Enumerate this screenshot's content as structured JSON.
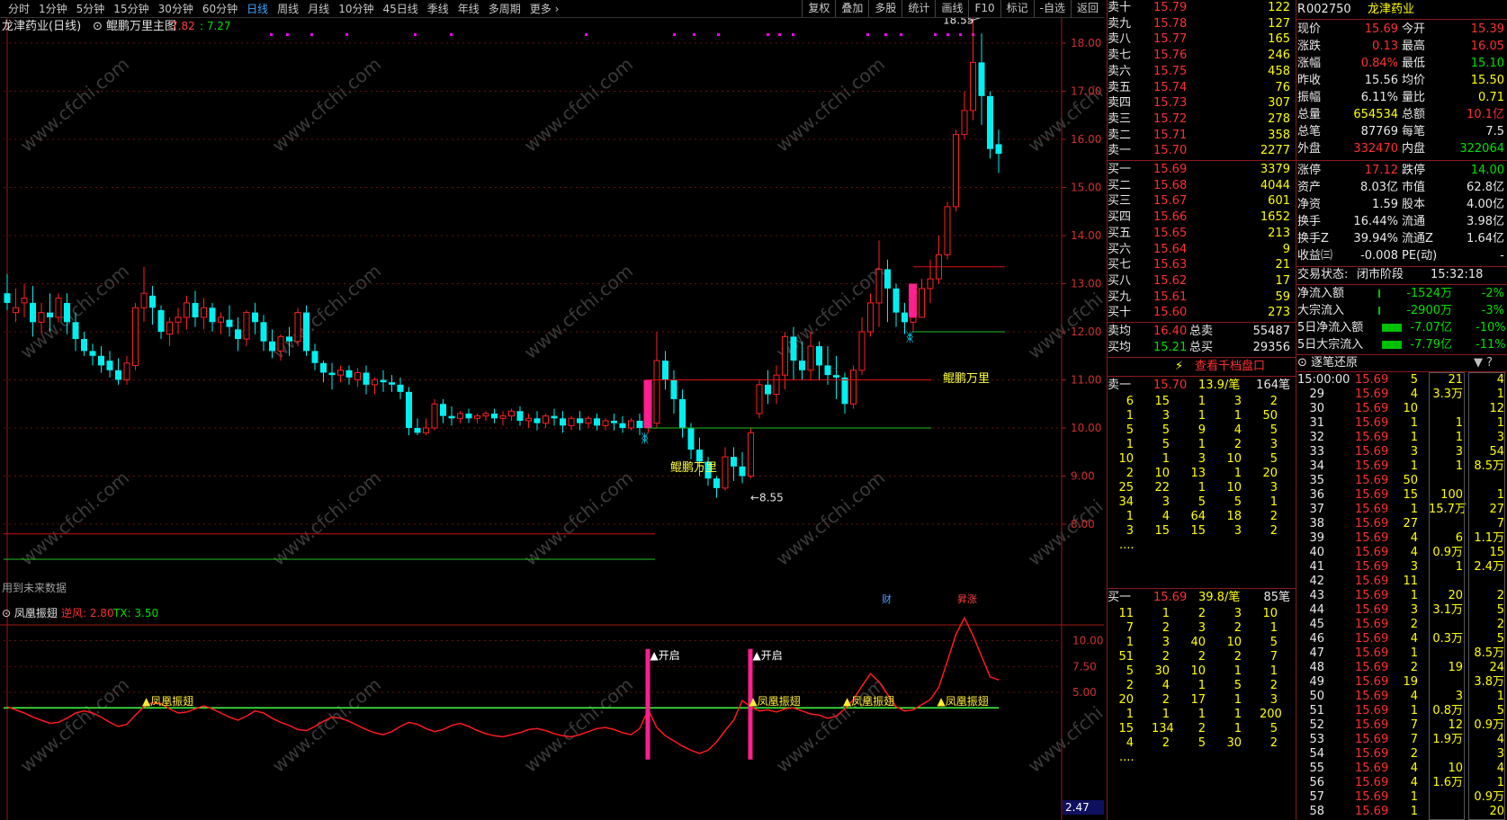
{
  "topbar": {
    "periods": [
      "分时",
      "1分钟",
      "5分钟",
      "15分钟",
      "30分钟",
      "60分钟",
      "日线",
      "周线",
      "月线",
      "10分钟",
      "45日线",
      "季线",
      "年线",
      "多周期",
      "更多 ›"
    ],
    "active": "日线",
    "tools": [
      "复权",
      "叠加",
      "多股",
      "统计",
      "画线",
      "F10",
      "标记",
      "-自选",
      "返回"
    ]
  },
  "chart": {
    "title": "龙津药业(日线)",
    "indicator": "鲲鹏万里主图",
    "v1": "7.82",
    "v2": "7.27",
    "yticks": [
      "18.00",
      "17.00",
      "16.00",
      "15.00",
      "14.00",
      "13.00",
      "12.00",
      "11.00",
      "10.00",
      "9.00",
      "8.00"
    ],
    "high_label": "18.55",
    "low_label": "8.55",
    "signal1": "鲲鹏万里",
    "signal2": "鲲鹏万里",
    "signal3": "鲲鹏万里",
    "future_note": "用到未来数据",
    "badge_cai": "财",
    "badge_zhang": "涨",
    "sub_name": "凤凰振翅",
    "sub_k1": "逆风:",
    "sub_v1": "2.80",
    "sub_k2": "TX:",
    "sub_v2": "3.50",
    "sub_yticks": [
      "10.00",
      "7.50",
      "5.00"
    ],
    "sub_low": "2.47",
    "open_label": "开启",
    "fh_label": "凤凰振翅",
    "watermark": "www.cfchi.com"
  },
  "candles": [
    [
      12.8,
      13.2,
      12.6,
      12.45
    ],
    [
      12.4,
      12.9,
      12.5,
      12.2
    ],
    [
      12.6,
      13.0,
      12.7,
      12.3
    ],
    [
      12.6,
      12.95,
      12.2,
      11.9
    ],
    [
      12.2,
      12.6,
      12.4,
      11.95
    ],
    [
      12.4,
      12.8,
      12.3,
      12.0
    ],
    [
      12.3,
      12.8,
      12.7,
      12.2
    ],
    [
      12.6,
      12.8,
      12.2,
      11.95
    ],
    [
      12.2,
      12.4,
      11.85,
      11.6
    ],
    [
      11.85,
      12.0,
      11.6,
      11.5
    ],
    [
      11.6,
      11.75,
      11.5,
      11.3
    ],
    [
      11.5,
      11.7,
      11.3,
      11.15
    ],
    [
      11.4,
      11.6,
      11.2,
      11.05
    ],
    [
      11.2,
      11.45,
      11.0,
      10.9
    ],
    [
      11.0,
      11.5,
      11.35,
      10.9
    ],
    [
      11.3,
      12.6,
      12.5,
      11.2
    ],
    [
      12.5,
      13.35,
      12.8,
      12.2
    ],
    [
      12.75,
      12.95,
      12.5,
      12.15
    ],
    [
      12.45,
      12.55,
      12.0,
      11.85
    ],
    [
      11.95,
      12.3,
      12.2,
      11.7
    ],
    [
      12.2,
      12.5,
      12.3,
      11.95
    ],
    [
      12.3,
      12.75,
      12.6,
      12.05
    ],
    [
      12.6,
      12.85,
      12.3,
      12.1
    ],
    [
      12.3,
      12.7,
      12.5,
      12.05
    ],
    [
      12.5,
      12.6,
      12.2,
      12.0
    ],
    [
      12.2,
      12.4,
      12.3,
      11.95
    ],
    [
      12.25,
      12.55,
      12.1,
      11.9
    ],
    [
      12.05,
      12.3,
      11.85,
      11.6
    ],
    [
      11.85,
      12.45,
      12.4,
      11.7
    ],
    [
      12.4,
      12.6,
      12.2,
      11.95
    ],
    [
      12.2,
      12.35,
      11.8,
      11.6
    ],
    [
      11.8,
      12.05,
      11.6,
      11.45
    ],
    [
      11.6,
      11.95,
      11.9,
      11.4
    ],
    [
      11.9,
      12.1,
      11.8,
      11.5
    ],
    [
      11.8,
      12.5,
      12.4,
      11.7
    ],
    [
      12.4,
      12.55,
      11.6,
      11.5
    ],
    [
      11.6,
      11.75,
      11.35,
      11.2
    ],
    [
      11.35,
      11.4,
      11.15,
      10.95
    ],
    [
      11.15,
      11.35,
      11.1,
      10.8
    ],
    [
      11.1,
      11.3,
      11.2,
      10.95
    ],
    [
      11.2,
      11.3,
      11.05,
      10.9
    ],
    [
      11.0,
      11.25,
      11.15,
      10.85
    ],
    [
      11.15,
      11.3,
      10.9,
      10.7
    ],
    [
      10.9,
      11.05,
      11.0,
      10.7
    ],
    [
      11.0,
      11.2,
      10.95,
      10.75
    ],
    [
      10.95,
      11.1,
      10.9,
      10.75
    ],
    [
      10.9,
      11.05,
      10.75,
      10.6
    ],
    [
      10.75,
      10.85,
      10.0,
      9.85
    ],
    [
      10.0,
      10.2,
      9.9,
      9.85
    ],
    [
      9.9,
      10.2,
      10.0,
      9.85
    ],
    [
      10.0,
      10.6,
      10.5,
      9.95
    ],
    [
      10.5,
      10.6,
      10.25,
      10.1
    ],
    [
      10.25,
      10.45,
      10.2,
      10.05
    ],
    [
      10.2,
      10.35,
      10.3,
      10.1
    ],
    [
      10.3,
      10.4,
      10.2,
      10.1
    ],
    [
      10.2,
      10.3,
      10.25,
      10.1
    ],
    [
      10.25,
      10.35,
      10.3,
      10.15
    ],
    [
      10.3,
      10.4,
      10.2,
      10.1
    ],
    [
      10.2,
      10.35,
      10.25,
      10.05
    ],
    [
      10.25,
      10.4,
      10.35,
      10.15
    ],
    [
      10.35,
      10.45,
      10.15,
      10.05
    ],
    [
      10.15,
      10.3,
      10.2,
      10.0
    ],
    [
      10.2,
      10.35,
      10.1,
      9.95
    ],
    [
      10.1,
      10.3,
      10.25,
      10.0
    ],
    [
      10.25,
      10.4,
      10.2,
      10.05
    ],
    [
      10.2,
      10.35,
      10.05,
      9.9
    ],
    [
      10.05,
      10.25,
      10.2,
      9.95
    ],
    [
      10.2,
      10.35,
      10.1,
      9.95
    ],
    [
      10.1,
      10.25,
      10.2,
      10.0
    ],
    [
      10.2,
      10.3,
      10.05,
      9.95
    ],
    [
      10.05,
      10.2,
      10.15,
      9.95
    ],
    [
      10.15,
      10.3,
      10.1,
      9.95
    ],
    [
      10.1,
      10.25,
      10.0,
      9.9
    ],
    [
      10.0,
      10.2,
      10.15,
      9.95
    ],
    [
      10.15,
      10.3,
      10.0,
      9.85
    ],
    [
      10.0,
      10.15,
      10.1,
      9.9
    ],
    [
      10.1,
      12.0,
      11.4,
      10.0
    ],
    [
      11.4,
      11.6,
      11.0,
      10.8
    ],
    [
      11.0,
      11.2,
      10.6,
      10.3
    ],
    [
      10.6,
      10.8,
      10.0,
      9.8
    ],
    [
      10.0,
      10.1,
      9.55,
      9.35
    ],
    [
      9.55,
      9.8,
      9.3,
      9.0
    ],
    [
      9.3,
      9.4,
      8.95,
      8.8
    ],
    [
      8.95,
      9.0,
      8.75,
      8.55
    ],
    [
      8.75,
      9.6,
      9.4,
      8.7
    ],
    [
      9.4,
      9.6,
      9.2,
      8.9
    ],
    [
      9.2,
      9.5,
      9.0,
      8.85
    ],
    [
      9.0,
      10.0,
      9.9,
      8.95
    ],
    [
      10.3,
      11.0,
      10.9,
      10.2
    ],
    [
      10.9,
      11.2,
      10.7,
      10.5
    ],
    [
      10.7,
      11.3,
      11.1,
      10.5
    ],
    [
      11.1,
      12.0,
      11.9,
      10.8
    ],
    [
      11.9,
      12.1,
      11.4,
      11.0
    ],
    [
      11.4,
      11.8,
      11.2,
      11.0
    ],
    [
      11.2,
      12.0,
      11.7,
      11.0
    ],
    [
      11.7,
      11.8,
      11.3,
      11.0
    ],
    [
      11.3,
      11.7,
      11.1,
      10.9
    ],
    [
      11.1,
      11.5,
      11.05,
      10.6
    ],
    [
      11.05,
      11.15,
      10.5,
      10.3
    ],
    [
      10.5,
      11.3,
      11.2,
      10.4
    ],
    [
      11.2,
      12.3,
      12.0,
      11.1
    ],
    [
      12.0,
      12.8,
      12.6,
      11.9
    ],
    [
      12.6,
      13.9,
      13.3,
      12.1
    ],
    [
      13.3,
      13.5,
      12.9,
      12.2
    ],
    [
      12.9,
      13.0,
      12.4,
      12.1
    ],
    [
      12.4,
      12.6,
      12.2,
      11.95
    ],
    [
      12.2,
      12.6,
      12.3,
      12.0
    ],
    [
      12.3,
      13.1,
      12.9,
      12.3
    ],
    [
      12.9,
      13.5,
      13.1,
      12.6
    ],
    [
      13.1,
      14.0,
      13.6,
      13.0
    ],
    [
      13.6,
      14.7,
      14.6,
      13.5
    ],
    [
      14.6,
      16.2,
      16.1,
      14.5
    ],
    [
      16.1,
      17.0,
      16.6,
      16.0
    ],
    [
      16.6,
      18.55,
      17.6,
      16.4
    ],
    [
      17.6,
      18.2,
      16.9,
      16.3
    ],
    [
      16.9,
      17.0,
      15.8,
      15.6
    ],
    [
      15.9,
      16.2,
      15.7,
      15.3
    ]
  ],
  "sub": [
    3.6,
    3.3,
    3.0,
    2.6,
    2.3,
    2.0,
    2.1,
    2.5,
    3.0,
    3.2,
    3.0,
    2.6,
    2.1,
    1.7,
    1.9,
    2.8,
    3.6,
    4.0,
    3.9,
    3.4,
    3.0,
    3.1,
    3.4,
    3.7,
    3.4,
    3.0,
    2.6,
    2.3,
    2.7,
    3.2,
    3.0,
    2.5,
    2.1,
    1.8,
    1.4,
    1.3,
    1.7,
    2.2,
    2.6,
    2.5,
    2.2,
    1.8,
    1.4,
    1.1,
    0.9,
    1.2,
    1.7,
    2.1,
    1.9,
    1.5,
    1.2,
    1.4,
    1.8,
    2.0,
    1.7,
    1.3,
    1.0,
    0.8,
    0.7,
    0.9,
    1.1,
    1.4,
    1.5,
    1.3,
    1.0,
    0.8,
    0.7,
    0.9,
    1.2,
    1.5,
    1.6,
    1.4,
    1.1,
    0.9,
    1.5,
    3.3,
    1.6,
    0.8,
    0.3,
    -0.2,
    -0.6,
    -0.9,
    -0.6,
    0.2,
    1.3,
    2.3,
    4.2,
    3.6,
    3.2,
    3.3,
    3.1,
    3.4,
    3.5,
    3.2,
    2.9,
    2.8,
    2.5,
    2.7,
    3.4,
    4.3,
    5.6,
    6.8,
    6.0,
    4.8,
    3.6,
    3.2,
    3.3,
    3.8,
    4.3,
    5.5,
    8.0,
    10.6,
    12.2,
    10.5,
    8.5,
    6.5,
    6.2
  ],
  "quote": {
    "sells": [
      {
        "l": "卖十",
        "p": "15.79",
        "v": "122"
      },
      {
        "l": "卖九",
        "p": "15.78",
        "v": "127"
      },
      {
        "l": "卖八",
        "p": "15.77",
        "v": "165"
      },
      {
        "l": "卖七",
        "p": "15.76",
        "v": "246"
      },
      {
        "l": "卖六",
        "p": "15.75",
        "v": "458"
      },
      {
        "l": "卖五",
        "p": "15.74",
        "v": "76"
      },
      {
        "l": "卖四",
        "p": "15.73",
        "v": "307"
      },
      {
        "l": "卖三",
        "p": "15.72",
        "v": "278"
      },
      {
        "l": "卖二",
        "p": "15.71",
        "v": "358"
      },
      {
        "l": "卖一",
        "p": "15.70",
        "v": "2277"
      }
    ],
    "buys": [
      {
        "l": "买一",
        "p": "15.69",
        "v": "3379"
      },
      {
        "l": "买二",
        "p": "15.68",
        "v": "4044"
      },
      {
        "l": "买三",
        "p": "15.67",
        "v": "601"
      },
      {
        "l": "买四",
        "p": "15.66",
        "v": "1652"
      },
      {
        "l": "买五",
        "p": "15.65",
        "v": "213"
      },
      {
        "l": "买六",
        "p": "15.64",
        "v": "9"
      },
      {
        "l": "买七",
        "p": "15.63",
        "v": "21"
      },
      {
        "l": "买八",
        "p": "15.62",
        "v": "17"
      },
      {
        "l": "买九",
        "p": "15.61",
        "v": "59"
      },
      {
        "l": "买十",
        "p": "15.60",
        "v": "273"
      }
    ],
    "avg": [
      {
        "l": "卖均",
        "p": "16.40",
        "k": "总卖",
        "v": "55487"
      },
      {
        "l": "买均",
        "p": "15.21",
        "k": "总买",
        "v": "29356"
      }
    ],
    "kilo_link": "查看千档盘口",
    "sell1": {
      "l": "卖一",
      "p": "15.70",
      "avg": "13.9/笔",
      "cnt": "164笔"
    },
    "sell1_orders": [
      [
        "6",
        "15",
        "1",
        "3",
        "2"
      ],
      [
        "1",
        "3",
        "1",
        "1",
        "50"
      ],
      [
        "5",
        "5",
        "9",
        "4",
        "5"
      ],
      [
        "1",
        "5",
        "1",
        "2",
        "3"
      ],
      [
        "10",
        "1",
        "3",
        "10",
        "5"
      ],
      [
        "2",
        "10",
        "13",
        "1",
        "20"
      ],
      [
        "25",
        "22",
        "1",
        "10",
        "3"
      ],
      [
        "34",
        "3",
        "5",
        "5",
        "1"
      ],
      [
        "1",
        "4",
        "64",
        "18",
        "2"
      ],
      [
        "3",
        "15",
        "15",
        "3",
        "2"
      ]
    ],
    "buy1": {
      "l": "买一",
      "p": "15.69",
      "avg": "39.8/笔",
      "cnt": "85笔"
    },
    "buy1_orders": [
      [
        "11",
        "1",
        "2",
        "3",
        "10"
      ],
      [
        "7",
        "2",
        "3",
        "2",
        "1"
      ],
      [
        "1",
        "3",
        "40",
        "10",
        "5"
      ],
      [
        "51",
        "2",
        "2",
        "2",
        "7"
      ],
      [
        "5",
        "30",
        "10",
        "1",
        "1"
      ],
      [
        "2",
        "4",
        "1",
        "5",
        "2"
      ],
      [
        "20",
        "2",
        "17",
        "1",
        "3"
      ],
      [
        "1",
        "1",
        "1",
        "1",
        "200"
      ],
      [
        "15",
        "134",
        "2",
        "1",
        "5"
      ],
      [
        "4",
        "2",
        "5",
        "30",
        "2"
      ]
    ],
    "ellipsis": "...."
  },
  "info": {
    "code": "002750",
    "name": "龙津药业",
    "r_mark": "R",
    "rows": [
      [
        "现价",
        "15.69",
        "r",
        "今开",
        "15.39",
        "r"
      ],
      [
        "涨跌",
        "0.13",
        "r",
        "最高",
        "16.05",
        "r"
      ],
      [
        "涨幅",
        "0.84%",
        "r",
        "最低",
        "15.10",
        "g"
      ],
      [
        "昨收",
        "15.56",
        "w",
        "均价",
        "15.50",
        "y"
      ],
      [
        "振幅",
        "6.11%",
        "w",
        "量比",
        "0.71",
        "y"
      ],
      [
        "总量",
        "654534",
        "y",
        "总额",
        "10.1亿",
        "r"
      ],
      [
        "总笔",
        "87769",
        "w",
        "每笔",
        "7.5",
        "w"
      ],
      [
        "外盘",
        "332470",
        "r",
        "内盘",
        "322064",
        "g"
      ]
    ],
    "rows2": [
      [
        "涨停",
        "17.12",
        "r",
        "跌停",
        "14.00",
        "g"
      ],
      [
        "资产",
        "8.03亿",
        "w",
        "市值",
        "62.8亿",
        "w"
      ],
      [
        "净资",
        "1.59",
        "w",
        "股本",
        "4.00亿",
        "w"
      ],
      [
        "换手",
        "16.44%",
        "w",
        "流通",
        "3.98亿",
        "w"
      ],
      [
        "换手Z",
        "39.94%",
        "w",
        "流通Z",
        "1.64亿",
        "w"
      ],
      [
        "收益㈢",
        "-0.008",
        "w",
        "PE(动)",
        "-",
        "w"
      ]
    ],
    "status_k": "交易状态:",
    "status_v": "闭市阶段",
    "status_t": "15:32:18",
    "flows": [
      [
        "净流入额",
        "-1524万",
        "-2%"
      ],
      [
        "大宗流入",
        "-2900万",
        "-3%"
      ],
      [
        "5日净流入额",
        "-7.07亿",
        "-10%"
      ],
      [
        "5日大宗流入",
        "-7.79亿",
        "-11%"
      ]
    ],
    "ticks_title": "逐笔还原",
    "ticks": [
      [
        "15:00:00",
        "15.69",
        "5"
      ],
      [
        "29",
        "15.69",
        "4"
      ],
      [
        "30",
        "15.69",
        "10"
      ],
      [
        "31",
        "15.69",
        "1"
      ],
      [
        "32",
        "15.69",
        "1"
      ],
      [
        "33",
        "15.69",
        "3"
      ],
      [
        "34",
        "15.69",
        "1"
      ],
      [
        "35",
        "15.69",
        "50"
      ],
      [
        "36",
        "15.69",
        "15"
      ],
      [
        "37",
        "15.69",
        "1"
      ],
      [
        "38",
        "15.69",
        "27"
      ],
      [
        "39",
        "15.69",
        "4"
      ],
      [
        "40",
        "15.69",
        "4"
      ],
      [
        "41",
        "15.69",
        "3"
      ],
      [
        "42",
        "15.69",
        "11"
      ],
      [
        "43",
        "15.69",
        "1"
      ],
      [
        "44",
        "15.69",
        "3"
      ],
      [
        "45",
        "15.69",
        "2"
      ],
      [
        "46",
        "15.69",
        "4"
      ],
      [
        "47",
        "15.69",
        "1"
      ],
      [
        "48",
        "15.69",
        "2"
      ],
      [
        "49",
        "15.69",
        "19"
      ],
      [
        "50",
        "15.69",
        "4"
      ],
      [
        "51",
        "15.69",
        "1"
      ],
      [
        "52",
        "15.69",
        "7"
      ],
      [
        "53",
        "15.69",
        "7"
      ],
      [
        "54",
        "15.69",
        "2"
      ],
      [
        "55",
        "15.69",
        "4"
      ],
      [
        "56",
        "15.69",
        "4"
      ],
      [
        "57",
        "15.69",
        "1"
      ],
      [
        "58",
        "15.69",
        "1"
      ]
    ],
    "ticks_b": [
      [
        "21",
        "4"
      ],
      [
        "3.3万",
        "1"
      ],
      [
        "",
        "12"
      ],
      [
        "1",
        "1"
      ],
      [
        "1",
        "3"
      ],
      [
        "3",
        "54"
      ],
      [
        "1",
        "8.5万"
      ],
      [
        "",
        ""
      ],
      [
        "100",
        "1"
      ],
      [
        "15.7万",
        "27"
      ],
      [
        "",
        "7"
      ],
      [
        "6",
        "1.1万"
      ],
      [
        "0.9万",
        "15"
      ],
      [
        "1",
        "2.4万"
      ],
      [
        "",
        ""
      ],
      [
        "20",
        "2"
      ],
      [
        "3.1万",
        "5"
      ],
      [
        "",
        "2"
      ],
      [
        "0.3万",
        "5"
      ],
      [
        "",
        "8.5万"
      ],
      [
        "19",
        "24"
      ],
      [
        "",
        "3.8万"
      ],
      [
        "3",
        "1"
      ],
      [
        "0.8万",
        "5"
      ],
      [
        "12",
        "0.9万"
      ],
      [
        "1.9万",
        "4"
      ],
      [
        "",
        "3"
      ],
      [
        "10",
        "4"
      ],
      [
        "1.6万",
        "1"
      ],
      [
        "",
        "0.9万"
      ],
      [
        "",
        "20"
      ]
    ]
  }
}
